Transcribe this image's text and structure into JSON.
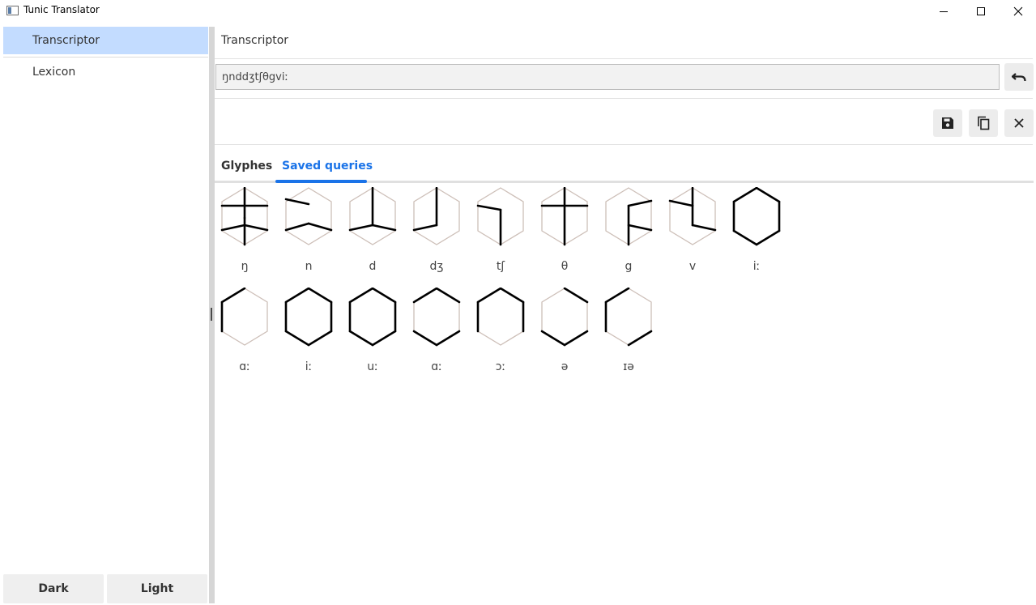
{
  "window": {
    "title": "Tunic Translator"
  },
  "sidebar": {
    "items": [
      {
        "label": "Transcriptor",
        "active": true
      },
      {
        "label": "Lexicon",
        "active": false
      }
    ],
    "theme_buttons": {
      "dark": "Dark",
      "light": "Light"
    }
  },
  "main": {
    "title": "Transcriptor",
    "query": {
      "value": "ŋnddʒtʃθgviː",
      "placeholder": ""
    },
    "buttons": [
      "undo-icon",
      "save-icon",
      "copy-icon",
      "close-icon"
    ],
    "tabs": [
      {
        "label": "Glyphes",
        "active": false
      },
      {
        "label": "Saved queries",
        "active": true
      }
    ],
    "glyphs": [
      {
        "label": "ŋ",
        "inner": [
          [
            0,
            0,
            0,
            37
          ],
          [
            0,
            37,
            0,
            70
          ],
          [
            -28,
            22,
            0,
            22
          ],
          [
            0,
            22,
            28,
            22
          ],
          [
            -28,
            52,
            0,
            46
          ],
          [
            0,
            46,
            28,
            52
          ]
        ],
        "outer": []
      },
      {
        "label": "n",
        "inner": [
          [
            -28,
            14,
            0,
            20
          ],
          [
            -28,
            52,
            0,
            44
          ],
          [
            0,
            44,
            28,
            52
          ]
        ],
        "outer": []
      },
      {
        "label": "d",
        "inner": [
          [
            0,
            0,
            0,
            46
          ],
          [
            -28,
            52,
            0,
            46
          ],
          [
            0,
            46,
            28,
            52
          ]
        ],
        "outer": []
      },
      {
        "label": "dʒ",
        "inner": [
          [
            0,
            0,
            0,
            46
          ],
          [
            -28,
            52,
            0,
            46
          ]
        ],
        "outer": []
      },
      {
        "label": "tʃ",
        "inner": [
          [
            -28,
            22,
            0,
            27
          ],
          [
            0,
            27,
            0,
            70
          ]
        ],
        "outer": []
      },
      {
        "label": "θ",
        "inner": [
          [
            0,
            0,
            0,
            70
          ],
          [
            -28,
            22,
            0,
            22
          ],
          [
            0,
            22,
            28,
            22
          ]
        ],
        "outer": []
      },
      {
        "label": "g",
        "inner": [
          [
            0,
            22,
            28,
            16
          ],
          [
            0,
            22,
            0,
            70
          ],
          [
            0,
            46,
            28,
            52
          ]
        ],
        "outer": []
      },
      {
        "label": "v",
        "inner": [
          [
            0,
            0,
            0,
            22
          ],
          [
            -28,
            16,
            0,
            22
          ],
          [
            0,
            22,
            0,
            46
          ],
          [
            0,
            46,
            28,
            52
          ]
        ],
        "outer": []
      },
      {
        "label": "iː",
        "inner": [],
        "outer": [
          [
            0,
            0,
            28,
            17
          ],
          [
            28,
            17,
            28,
            53
          ],
          [
            28,
            53,
            0,
            70
          ],
          [
            0,
            70,
            -28,
            53
          ],
          [
            -28,
            53,
            -28,
            17
          ],
          [
            -28,
            17,
            0,
            0
          ]
        ]
      },
      {
        "label": "ɑː",
        "inner": [],
        "outer": [
          [
            -28,
            17,
            0,
            0
          ],
          [
            -28,
            17,
            -28,
            53
          ]
        ]
      },
      {
        "label": "iː",
        "inner": [],
        "outer": [
          [
            0,
            0,
            28,
            17
          ],
          [
            28,
            17,
            28,
            53
          ],
          [
            28,
            53,
            0,
            70
          ],
          [
            0,
            70,
            -28,
            53
          ],
          [
            -28,
            53,
            -28,
            17
          ],
          [
            -28,
            17,
            0,
            0
          ]
        ]
      },
      {
        "label": "uː",
        "inner": [],
        "outer": [
          [
            0,
            0,
            28,
            17
          ],
          [
            28,
            17,
            28,
            53
          ],
          [
            0,
            70,
            -28,
            53
          ],
          [
            -28,
            53,
            -28,
            17
          ],
          [
            -28,
            17,
            0,
            0
          ],
          [
            0,
            70,
            28,
            53
          ]
        ]
      },
      {
        "label": "ɑː",
        "inner": [],
        "outer": [
          [
            0,
            0,
            28,
            17
          ],
          [
            28,
            53,
            0,
            70
          ],
          [
            0,
            70,
            -28,
            53
          ],
          [
            -28,
            17,
            0,
            0
          ]
        ]
      },
      {
        "label": "ɔː",
        "inner": [],
        "outer": [
          [
            0,
            0,
            28,
            17
          ],
          [
            28,
            17,
            28,
            53
          ],
          [
            -28,
            53,
            -28,
            17
          ],
          [
            -28,
            17,
            0,
            0
          ]
        ]
      },
      {
        "label": "ə",
        "inner": [],
        "outer": [
          [
            0,
            0,
            28,
            17
          ],
          [
            28,
            53,
            0,
            70
          ],
          [
            0,
            70,
            -28,
            53
          ]
        ]
      },
      {
        "label": "ɪə",
        "inner": [],
        "outer": [
          [
            -28,
            17,
            0,
            0
          ],
          [
            -28,
            17,
            -28,
            53
          ],
          [
            28,
            53,
            0,
            70
          ]
        ]
      }
    ]
  }
}
